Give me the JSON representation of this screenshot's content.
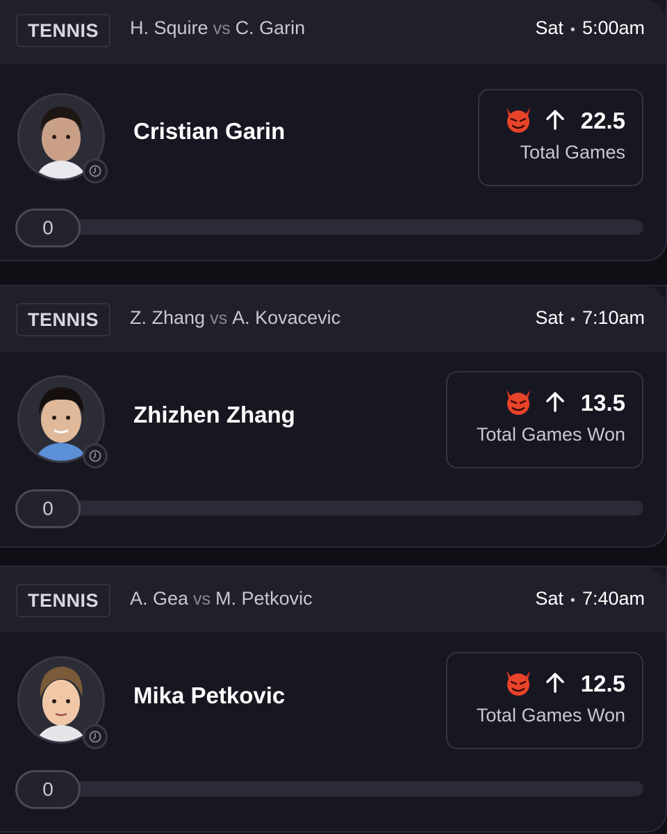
{
  "cards": [
    {
      "sport": "TENNIS",
      "player1": "H. Squire",
      "vs": "vs",
      "player2": "C. Garin",
      "day": "Sat",
      "time": "5:00am",
      "pick_player": "Cristian Garin",
      "direction_icon": "arrow-up-icon",
      "line": "22.5",
      "stat": "Total Games",
      "progress_value": "0",
      "avatar_icon": "player-photo"
    },
    {
      "sport": "TENNIS",
      "player1": "Z. Zhang",
      "vs": "vs",
      "player2": "A. Kovacevic",
      "day": "Sat",
      "time": "7:10am",
      "pick_player": "Zhizhen Zhang",
      "direction_icon": "arrow-up-icon",
      "line": "13.5",
      "stat": "Total Games Won",
      "progress_value": "0",
      "avatar_icon": "player-photo"
    },
    {
      "sport": "TENNIS",
      "player1": "A. Gea",
      "vs": "vs",
      "player2": "M. Petkovic",
      "day": "Sat",
      "time": "7:40am",
      "pick_player": "Mika Petkovic",
      "direction_icon": "arrow-up-icon",
      "line": "12.5",
      "stat": "Total Games Won",
      "progress_value": "0",
      "avatar_icon": "player-photo"
    }
  ],
  "colors": {
    "background": "#0f0f16",
    "card": "#171722",
    "header": "#20202b",
    "devil": "#e8442a"
  }
}
